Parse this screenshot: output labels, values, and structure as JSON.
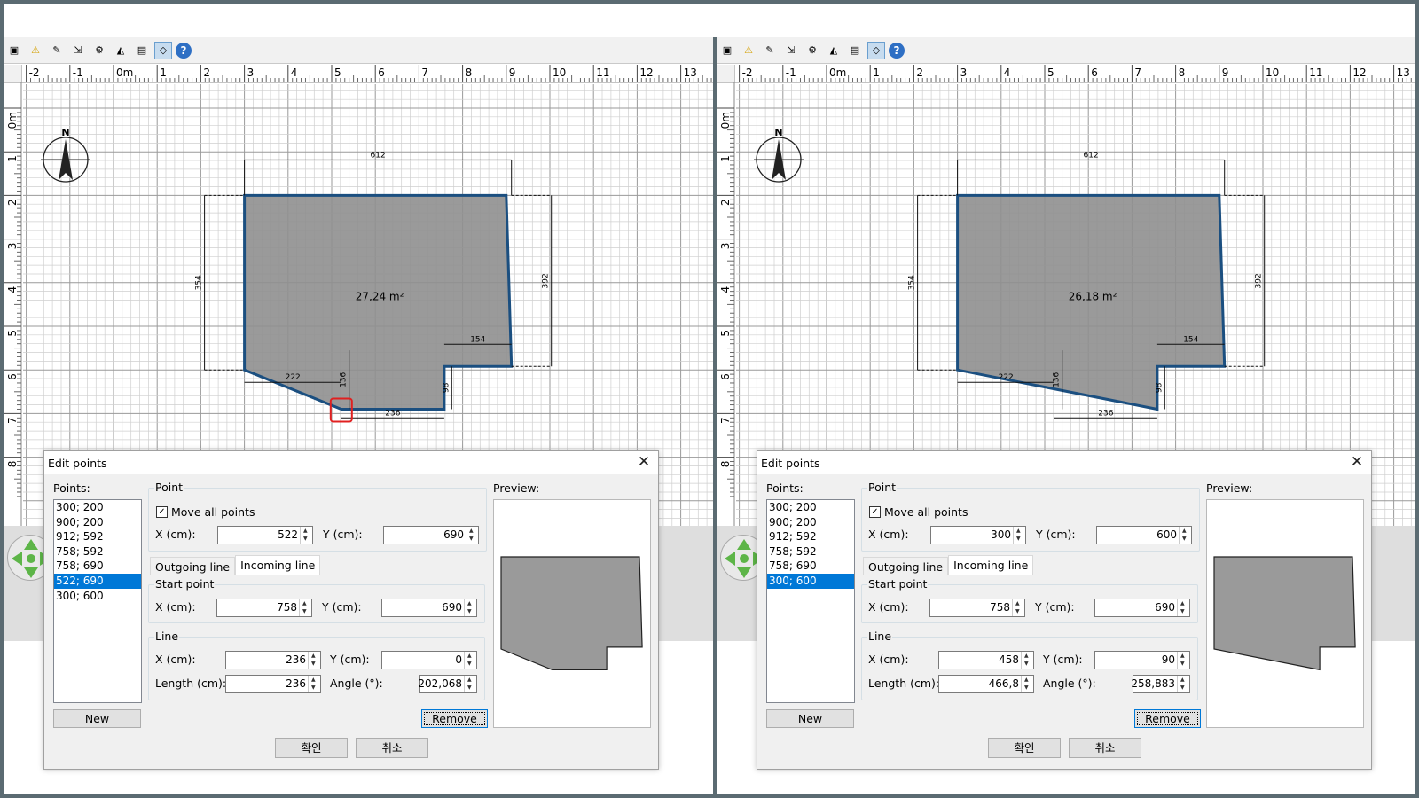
{
  "toolbar_icons": [
    "save-icon",
    "warning-icon",
    "edit-icon",
    "export-icon",
    "preferences-icon",
    "mirror-icon",
    "plan-icon",
    "wall-icon",
    "help-icon"
  ],
  "left": {
    "ruler": {
      "x_labels": [
        "-2",
        "-1",
        "0m",
        "1",
        "2",
        "3",
        "4",
        "5",
        "6",
        "7",
        "8",
        "9",
        "10",
        "11",
        "12",
        "13"
      ],
      "y_labels": [
        "0m",
        "1",
        "2",
        "3",
        "4",
        "5",
        "6",
        "7",
        "8"
      ]
    },
    "plan": {
      "area": "27,24 m²",
      "dims": {
        "top": "612",
        "left": "354",
        "right": "392",
        "bottom_right_width": "154",
        "notch_width": "222",
        "notch_height": "136",
        "step_height": "98",
        "bottom_width": "236"
      }
    },
    "dialog": {
      "title": "Edit points",
      "points_label": "Points:",
      "points": [
        "300; 200",
        "900; 200",
        "912; 592",
        "758; 592",
        "758; 690",
        "522; 690",
        "300; 600"
      ],
      "selected_index": 5,
      "new_label": "New",
      "point_group": "Point",
      "move_all": "Move all points",
      "x_label": "X (cm):",
      "y_label": "Y (cm):",
      "x_value": "522",
      "y_value": "690",
      "tab_outgoing": "Outgoing line",
      "tab_incoming": "Incoming line",
      "start_group": "Start point",
      "start_x": "758",
      "start_y": "690",
      "line_group": "Line",
      "line_x": "236",
      "line_y": "0",
      "length_label": "Length (cm):",
      "angle_label": "Angle (°):",
      "length": "236",
      "angle": "202,068",
      "remove_label": "Remove",
      "preview_label": "Preview:",
      "ok_label": "확인",
      "cancel_label": "취소"
    }
  },
  "right": {
    "ruler": {
      "x_labels": [
        "-2",
        "-1",
        "0m",
        "1",
        "2",
        "3",
        "4",
        "5",
        "6",
        "7",
        "8",
        "9",
        "10",
        "11",
        "12",
        "13"
      ],
      "y_labels": [
        "0m",
        "1",
        "2",
        "3",
        "4",
        "5",
        "6",
        "7",
        "8"
      ]
    },
    "plan": {
      "area": "26,18 m²",
      "dims": {
        "top": "612",
        "left": "354",
        "right": "392",
        "bottom_right_width": "154",
        "notch_width": "222",
        "notch_height": "136",
        "step_height": "98",
        "bottom_width": "236"
      }
    },
    "dialog": {
      "title": "Edit points",
      "points_label": "Points:",
      "points": [
        "300; 200",
        "900; 200",
        "912; 592",
        "758; 592",
        "758; 690",
        "300; 600"
      ],
      "selected_index": 5,
      "new_label": "New",
      "point_group": "Point",
      "move_all": "Move all points",
      "x_label": "X (cm):",
      "y_label": "Y (cm):",
      "x_value": "300",
      "y_value": "600",
      "tab_outgoing": "Outgoing line",
      "tab_incoming": "Incoming line",
      "start_group": "Start point",
      "start_x": "758",
      "start_y": "690",
      "line_group": "Line",
      "line_x": "458",
      "line_y": "90",
      "length_label": "Length (cm):",
      "angle_label": "Angle (°):",
      "length": "466,8",
      "angle": "258,883",
      "remove_label": "Remove",
      "preview_label": "Preview:",
      "ok_label": "확인",
      "cancel_label": "취소"
    }
  }
}
